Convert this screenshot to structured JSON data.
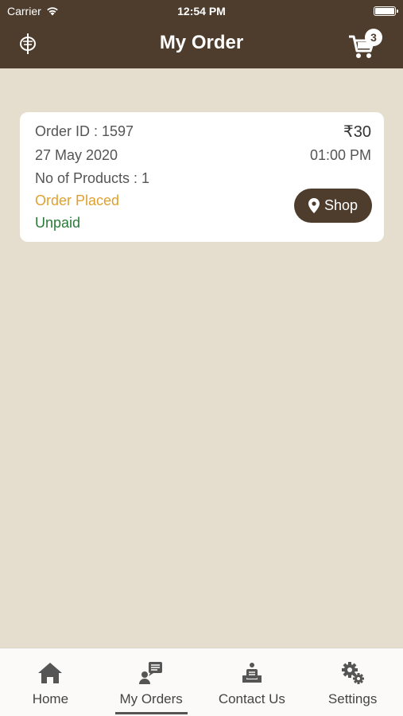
{
  "status_bar": {
    "carrier": "Carrier",
    "time": "12:54 PM"
  },
  "nav": {
    "title": "My Order",
    "cart_count": "3",
    "logo_icon": "brand-logo-icon",
    "cart_icon": "cart-icon"
  },
  "order": {
    "id_text": "Order ID : 1597",
    "price": "₹30",
    "date": "27 May 2020",
    "time": "01:00 PM",
    "products_text": "No of Products : 1",
    "status": "Order Placed",
    "payment": "Unpaid",
    "shop_label": "Shop"
  },
  "tabs": [
    {
      "label": "Home",
      "icon": "home-icon"
    },
    {
      "label": "My Orders",
      "icon": "orders-icon",
      "active": true
    },
    {
      "label": "Contact Us",
      "icon": "contact-icon"
    },
    {
      "label": "Settings",
      "icon": "gears-icon"
    }
  ],
  "colors": {
    "brand": "#4e3d2d",
    "background": "#e5dece",
    "status_placed": "#e0a030",
    "status_unpaid": "#2a7a3a"
  }
}
